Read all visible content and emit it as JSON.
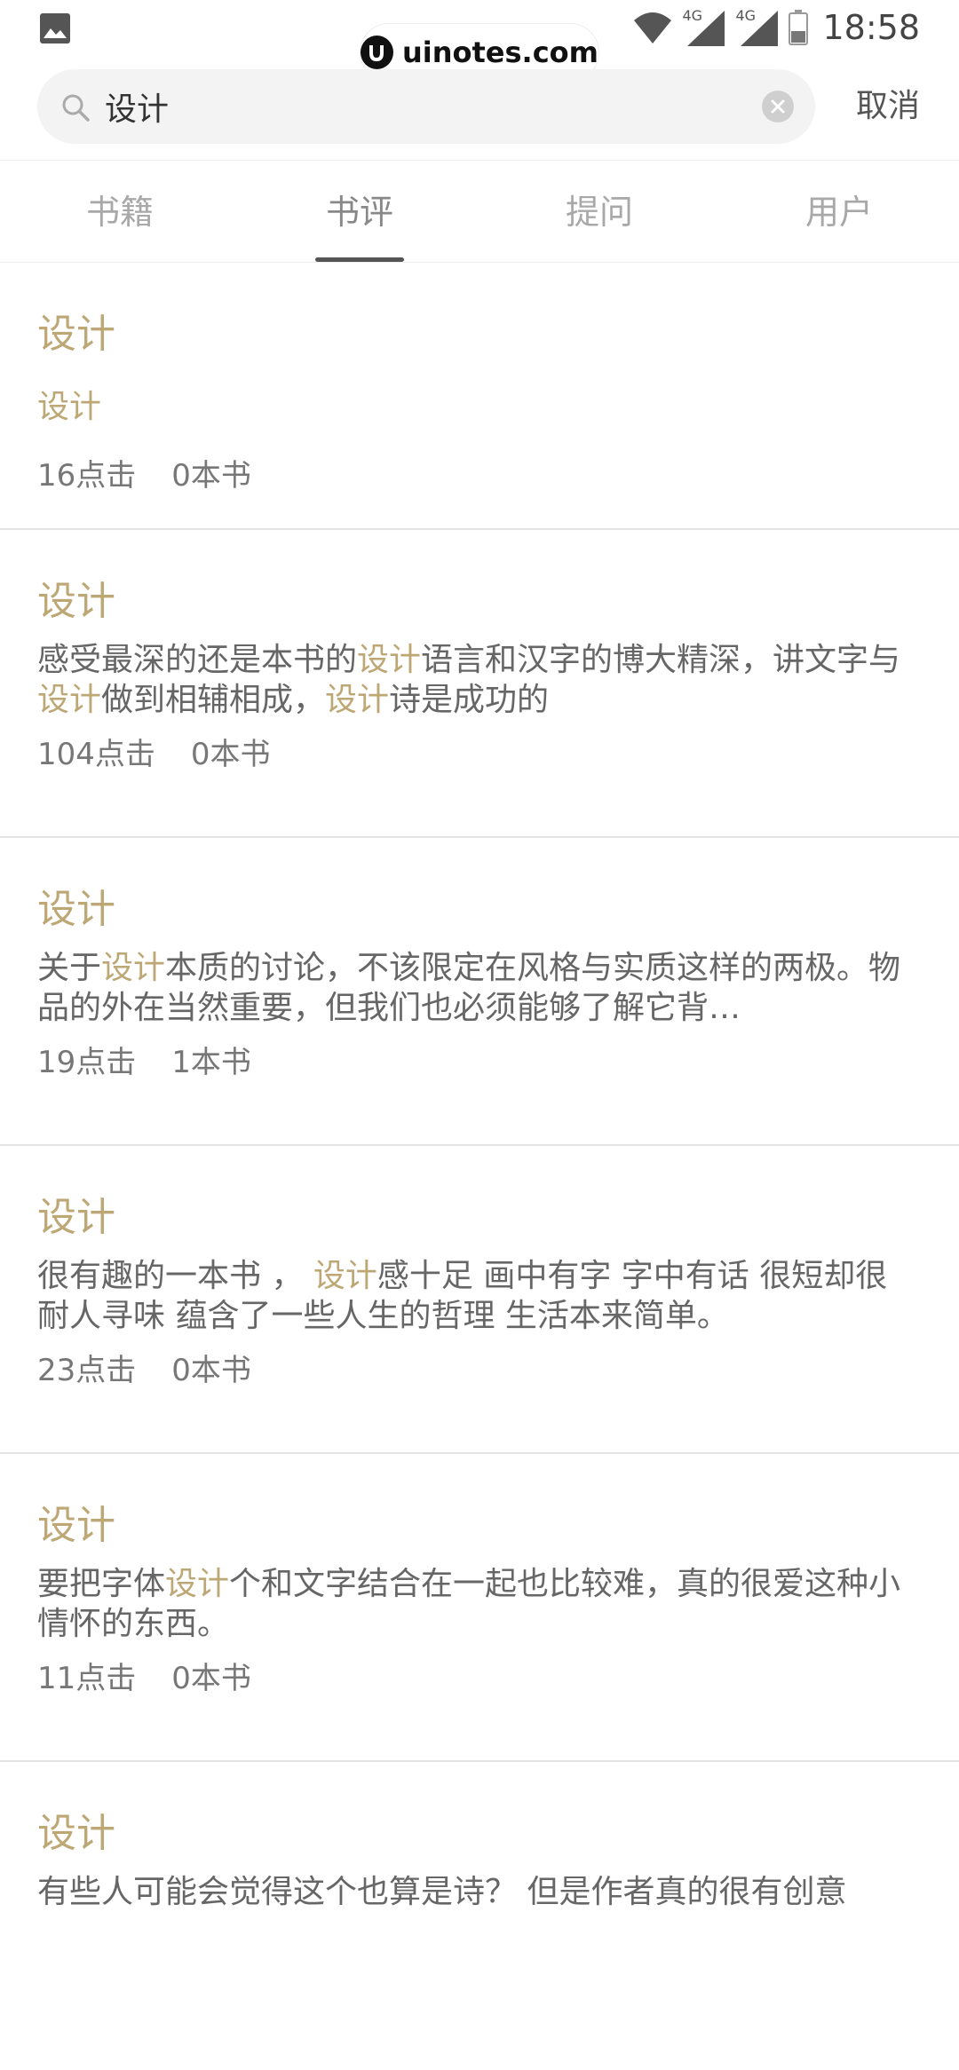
{
  "status_bar": {
    "time": "18:58",
    "network_1": "4G",
    "network_2": "4G",
    "icons": [
      "gallery-icon",
      "wifi-icon",
      "signal-icon",
      "battery-icon"
    ]
  },
  "watermark": {
    "text": "uinotes.com"
  },
  "search": {
    "value": "设计",
    "placeholder": "",
    "cancel_label": "取消"
  },
  "tabs": [
    {
      "label": "书籍",
      "active": false
    },
    {
      "label": "书评",
      "active": true
    },
    {
      "label": "提问",
      "active": false
    },
    {
      "label": "用户",
      "active": false
    }
  ],
  "results": [
    {
      "title": "设计",
      "snippet_parts": [
        {
          "t": "设计",
          "hl": true
        }
      ],
      "clicks": "16点击",
      "books": "0本书"
    },
    {
      "title": "设计",
      "snippet_parts": [
        {
          "t": "感受最深的还是本书的",
          "hl": false
        },
        {
          "t": "设计",
          "hl": true
        },
        {
          "t": "语言和汉字的博大精深，讲文字与",
          "hl": false
        },
        {
          "t": "设计",
          "hl": true
        },
        {
          "t": "做到相辅相成，",
          "hl": false
        },
        {
          "t": "设计",
          "hl": true
        },
        {
          "t": "诗是成功的",
          "hl": false
        }
      ],
      "clicks": "104点击",
      "books": "0本书"
    },
    {
      "title": "设计",
      "snippet_parts": [
        {
          "t": "关于",
          "hl": false
        },
        {
          "t": "设计",
          "hl": true
        },
        {
          "t": "本质的讨论，不该限定在风格与实质这样的两极。物品的外在当然重要，但我们也必须能够了解它背…",
          "hl": false
        }
      ],
      "clicks": "19点击",
      "books": "1本书"
    },
    {
      "title": "设计",
      "snippet_parts": [
        {
          "t": "很有趣的一本书 ， ",
          "hl": false
        },
        {
          "t": "设计",
          "hl": true
        },
        {
          "t": "感十足  画中有字 字中有话 很短却很耐人寻味 蕴含了一些人生的哲理 生活本来简单。",
          "hl": false
        }
      ],
      "clicks": "23点击",
      "books": "0本书"
    },
    {
      "title": "设计",
      "snippet_parts": [
        {
          "t": "要把字体",
          "hl": false
        },
        {
          "t": "设计",
          "hl": true
        },
        {
          "t": "个和文字结合在一起也比较难，真的很爱这种小情怀的东西。",
          "hl": false
        }
      ],
      "clicks": "11点击",
      "books": "0本书"
    },
    {
      "title": "设计",
      "snippet_parts": [
        {
          "t": "有些人可能会觉得这个也算是诗？ 但是作者真的很有创意",
          "hl": false
        }
      ],
      "clicks": "",
      "books": ""
    }
  ]
}
